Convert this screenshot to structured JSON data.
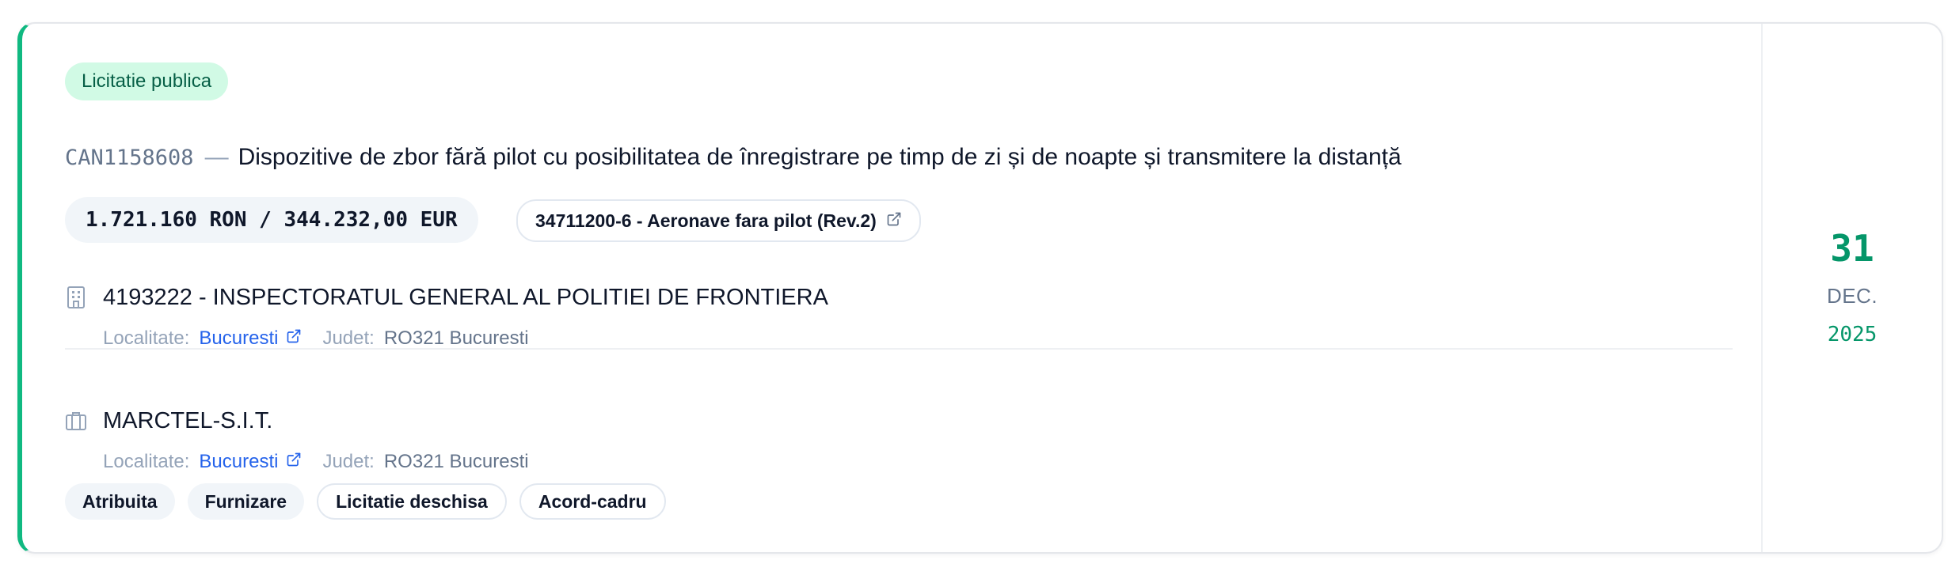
{
  "card": {
    "type_badge": "Licitatie publica",
    "code": "CAN1158608",
    "separator": "—",
    "title": "Dispozitive de zbor fără pilot cu posibilitatea de înregistrare pe timp de zi și de noapte și transmitere la distanță",
    "value": "1.721.160 RON / 344.232,00 EUR",
    "cpv": "34711200-6 - Aeronave fara pilot (Rev.2)",
    "accent_color": "#10b981"
  },
  "authority": {
    "icon": "building-icon",
    "name": "4193222 - INSPECTORATUL GENERAL AL POLITIEI DE FRONTIERA",
    "locality_label": "Localitate:",
    "locality": "Bucuresti",
    "county_label": "Judet:",
    "county": "RO321 Bucuresti"
  },
  "supplier": {
    "icon": "briefcase-icon",
    "name": "MARCTEL-S.I.T.",
    "locality_label": "Localitate:",
    "locality": "Bucuresti",
    "county_label": "Judet:",
    "county": "RO321 Bucuresti"
  },
  "tags": {
    "t1": "Atribuita",
    "t2": "Furnizare",
    "t3": "Licitatie deschisa",
    "t4": "Acord-cadru"
  },
  "date": {
    "day": "31",
    "month": "DEC.",
    "year": "2025"
  }
}
